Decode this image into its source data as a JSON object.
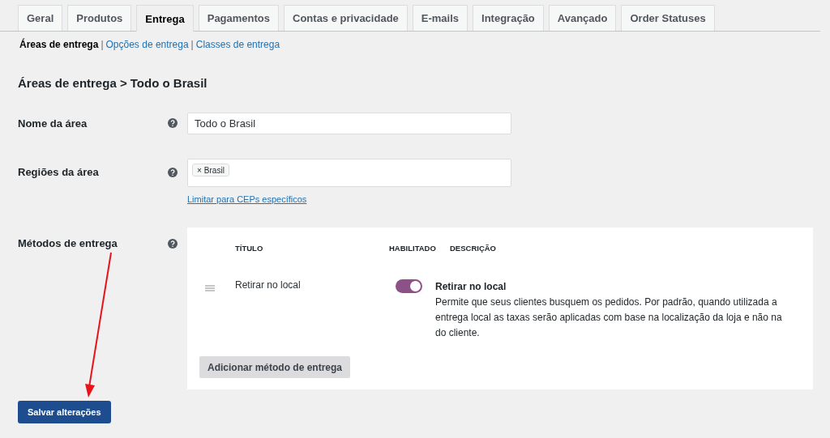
{
  "tabs": [
    {
      "label": "Geral",
      "selected": false
    },
    {
      "label": "Produtos",
      "selected": false
    },
    {
      "label": "Entrega",
      "selected": true
    },
    {
      "label": "Pagamentos",
      "selected": false
    },
    {
      "label": "Contas e privacidade",
      "selected": false
    },
    {
      "label": "E-mails",
      "selected": false
    },
    {
      "label": "Integração",
      "selected": false
    },
    {
      "label": "Avançado",
      "selected": false
    },
    {
      "label": "Order Statuses",
      "selected": false
    }
  ],
  "subnav": [
    {
      "label": "Áreas de entrega",
      "selected": true
    },
    {
      "label": "Opções de entrega",
      "selected": false
    },
    {
      "label": "Classes de entrega",
      "selected": false
    }
  ],
  "subnav_separator": "|",
  "heading": "Áreas de entrega > Todo o Brasil",
  "zone_name": {
    "label": "Nome da área",
    "value": "Todo o Brasil"
  },
  "zone_regions": {
    "label": "Regiões da área",
    "tags": [
      "Brasil"
    ],
    "tag_remove": "×",
    "link": "Limitar para CEPs específicos"
  },
  "methods": {
    "label": "Métodos de entrega",
    "columns": [
      "TÍTULO",
      "HABILITADO",
      "DESCRIÇÃO"
    ],
    "rows": [
      {
        "title": "Retirar no local",
        "on": true,
        "desc_title": "Retirar no local",
        "description": "Permite que seus clientes busquem os pedidos. Por padrão, quando utilizada a entrega local as taxas serão aplicadas com base na localização da loja e não na do cliente."
      }
    ],
    "add_button": "Adicionar método de entrega"
  },
  "save_button": "Salvar alterações"
}
